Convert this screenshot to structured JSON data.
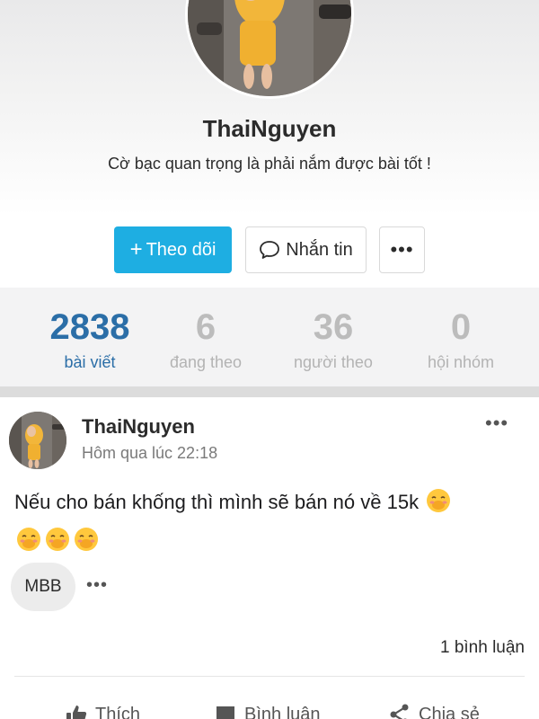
{
  "profile": {
    "name": "ThaiNguyen",
    "bio": "Cờ bạc quan trọng là phải nắm được bài tốt !",
    "follow_label": "Theo dõi",
    "follow_plus": "+",
    "message_label": "Nhắn tin",
    "more_label": "•••"
  },
  "stats": [
    {
      "value": "2838",
      "label": "bài viết"
    },
    {
      "value": "6",
      "label": "đang theo"
    },
    {
      "value": "36",
      "label": "người theo"
    },
    {
      "value": "0",
      "label": "hội nhóm"
    }
  ],
  "post": {
    "author": "ThaiNguyen",
    "time": "Hôm qua lúc 22:18",
    "menu_label": "•••",
    "text": "Nếu cho bán khống thì mình sẽ bán nó về 15k",
    "emoji": [
      "face-with-hand-over-mouth-emoji",
      "face-with-hand-over-mouth-emoji",
      "face-with-hand-over-mouth-emoji",
      "face-with-hand-over-mouth-emoji"
    ],
    "tag": "MBB",
    "tag_more": "•••",
    "comment_count": "1 bình luận",
    "actions": {
      "like": "Thích",
      "comment": "Bình luận",
      "share": "Chia sẻ"
    }
  },
  "colors": {
    "accent": "#1eaee2",
    "stat_active": "#2b6ea7",
    "stat_inactive": "#bcbcbc"
  }
}
